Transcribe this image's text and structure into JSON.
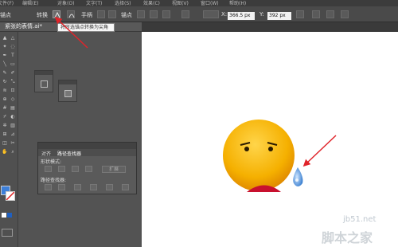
{
  "menubar": {
    "items": [
      {
        "label": "文件(F)"
      },
      {
        "label": "编辑(E)"
      },
      {
        "label": "对象(O)"
      },
      {
        "label": "文字(T)"
      },
      {
        "label": "选择(S)"
      },
      {
        "label": "效果(C)"
      },
      {
        "label": "视图(V)"
      },
      {
        "label": "窗口(W)"
      },
      {
        "label": "帮助(H)"
      }
    ]
  },
  "control_bar": {
    "left_label": "锚点",
    "convert_label": "转换",
    "handle_label": "手柄",
    "anchor_label": "锚点",
    "x_value": "366.5 px",
    "y_value": "392 px"
  },
  "document": {
    "tab_title": "紧张的表情.ai*"
  },
  "tooltip": {
    "text": "将所选锚点转换为尖角"
  },
  "pathfinder": {
    "tabs": [
      {
        "label": "对齐"
      },
      {
        "label": "路径查找器"
      }
    ],
    "shape_modes_label": "形状模式:",
    "expand_label": "扩展",
    "pathfinders_label": "路径查找器:"
  },
  "watermark": {
    "site": "jb51.net",
    "name": "脚本之家"
  },
  "colors": {
    "annotation_arrow": "#e0242a",
    "emoji_face": "#f5b000",
    "emoji_mouth": "#c8102e",
    "tear": "#3a7fd0"
  },
  "icons": [
    "convert-corner-icon",
    "convert-smooth-icon",
    "selection-tool-icon",
    "direct-selection-icon",
    "pen-tool-icon",
    "type-tool-icon",
    "line-tool-icon",
    "rectangle-tool-icon",
    "brush-tool-icon",
    "pencil-tool-icon",
    "rotate-tool-icon",
    "scale-tool-icon",
    "width-tool-icon",
    "free-transform-icon",
    "shape-builder-icon",
    "graph-tool-icon",
    "mesh-tool-icon",
    "gradient-tool-icon",
    "eyedropper-tool-icon",
    "blend-tool-icon",
    "hand-tool-icon",
    "zoom-tool-icon",
    "fill-swatch-icon",
    "stroke-swatch-icon",
    "screen-mode-icon"
  ]
}
